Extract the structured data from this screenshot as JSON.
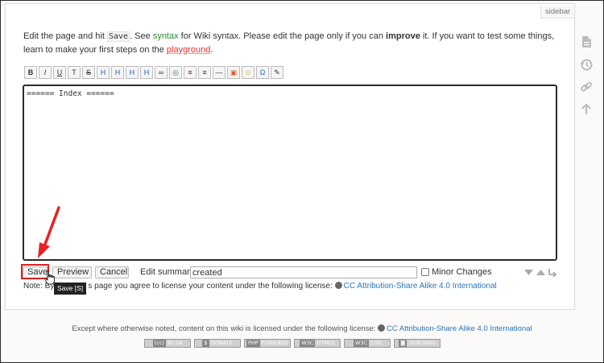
{
  "sidebar_tab": "sidebar",
  "intro": {
    "p1": "Edit the page and hit ",
    "save_code": "Save",
    "p2": ". See ",
    "syntax_link": "syntax",
    "p3": " for Wiki syntax. Please edit the page only if you can ",
    "improve": "improve",
    "p4": " it. If you want to test some things, learn to make your first steps on the ",
    "playground_link": "playground",
    "p5": "."
  },
  "toolbar": {
    "items": [
      {
        "name": "bold-button",
        "glyph": "B"
      },
      {
        "name": "italic-button",
        "glyph": "I"
      },
      {
        "name": "underline-button",
        "glyph": "U"
      },
      {
        "name": "monospace-button",
        "glyph": "T"
      },
      {
        "name": "strike-button",
        "glyph": "S"
      },
      {
        "name": "heading-same-button",
        "glyph": "H"
      },
      {
        "name": "heading-lower-button",
        "glyph": "H"
      },
      {
        "name": "heading-higher-button",
        "glyph": "H"
      },
      {
        "name": "heading-menu-button",
        "glyph": "H"
      },
      {
        "name": "link-button",
        "glyph": "∞"
      },
      {
        "name": "external-link-button",
        "glyph": "◎"
      },
      {
        "name": "ordered-list-button",
        "glyph": "≡"
      },
      {
        "name": "unordered-list-button",
        "glyph": "≡"
      },
      {
        "name": "horizontal-rule-button",
        "glyph": "—"
      },
      {
        "name": "media-button",
        "glyph": "▣"
      },
      {
        "name": "smiley-button",
        "glyph": "☺"
      },
      {
        "name": "special-chars-button",
        "glyph": "Ω"
      },
      {
        "name": "signature-button",
        "glyph": "✎"
      }
    ]
  },
  "editor": {
    "content": "====== Index ======"
  },
  "buttons": {
    "save": "Save",
    "preview": "Preview",
    "cancel": "Cancel"
  },
  "summary": {
    "label": "Edit summary",
    "value": "created"
  },
  "minor": {
    "label": "Minor Changes",
    "checked": false
  },
  "tooltip": "Save [S]",
  "license": {
    "prefix": "Note: By",
    "suffix": "s page you agree to license your content under the following license:",
    "link": "CC Attribution-Share Alike 4.0 International"
  },
  "footer": {
    "text": "Except where otherwise noted, content on this wiki is licensed under the following license:",
    "link": "CC Attribution-Share Alike 4.0 International"
  },
  "badges": [
    {
      "name": "cc-badge",
      "key": "(cc)",
      "text": "BY-SA"
    },
    {
      "name": "donate-badge",
      "key": "$",
      "text": "DONATE"
    },
    {
      "name": "php-badge",
      "key": "PHP",
      "text": "POWERED"
    },
    {
      "name": "w3c-html-badge",
      "key": "W3C",
      "text": "HTML5"
    },
    {
      "name": "w3c-css-badge",
      "key": "W3C",
      "text": "CSS"
    },
    {
      "name": "dokuwiki-badge",
      "key": "◙",
      "text": "DOKUWIKI"
    }
  ],
  "side_tools": [
    "show-page-icon",
    "old-revisions-icon",
    "backlinks-icon",
    "back-to-top-icon"
  ],
  "colors": {
    "accent_red": "#e02020",
    "link_blue": "#2b73b7",
    "link_green": "#2f8a2f"
  }
}
